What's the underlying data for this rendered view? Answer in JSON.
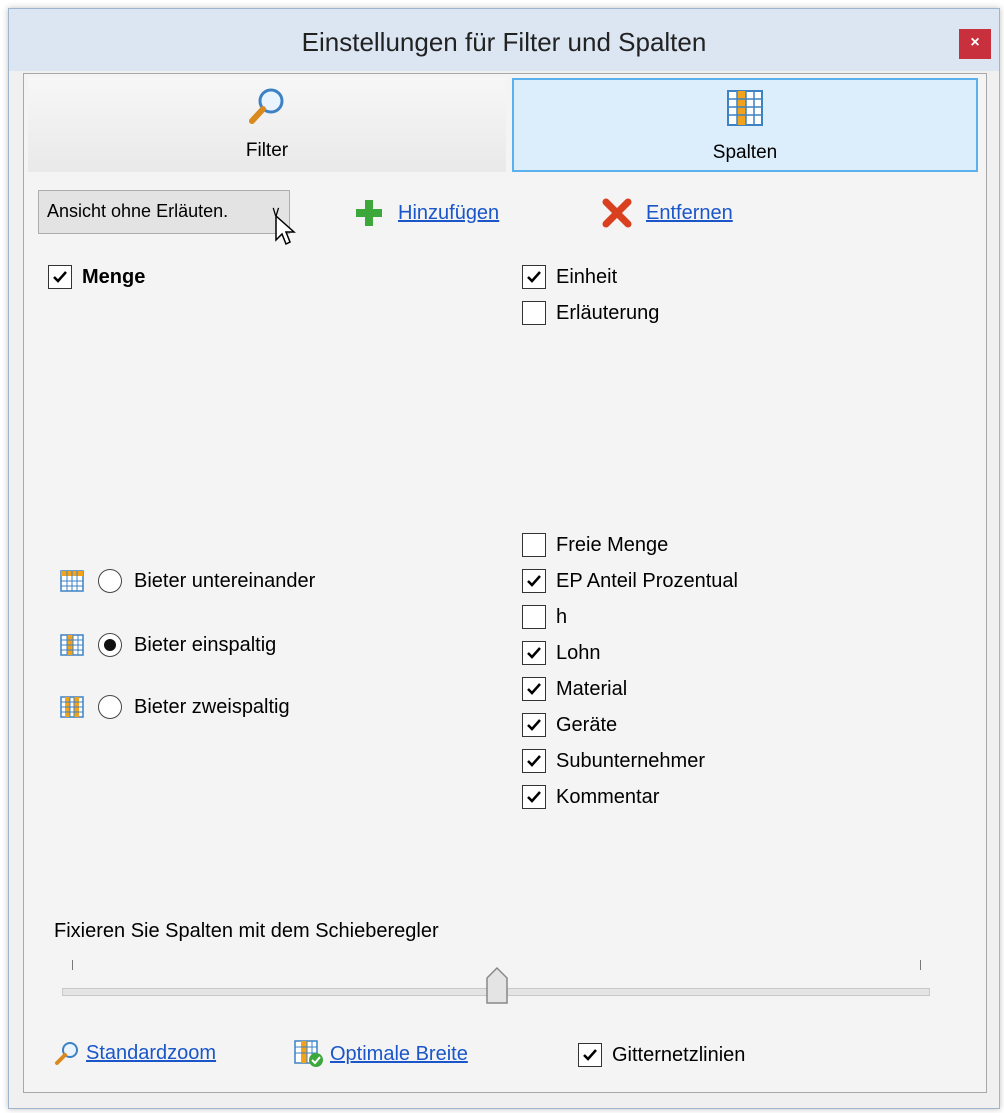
{
  "window": {
    "title": "Einstellungen für Filter und Spalten",
    "close_label": "×"
  },
  "tabs": [
    {
      "label": "Filter",
      "icon": "magnifier-icon",
      "active": false
    },
    {
      "label": "Spalten",
      "icon": "columns-grid-icon",
      "active": true
    }
  ],
  "toolbar": {
    "view_select_value": "Ansicht ohne Erläuten.",
    "add_label": "Hinzufügen",
    "remove_label": "Entfernen"
  },
  "left_columns": [
    {
      "label": "Menge",
      "checked": true,
      "bold": true
    }
  ],
  "right_top_columns": [
    {
      "label": "Einheit",
      "checked": true
    },
    {
      "label": "Erläuterung",
      "checked": false
    }
  ],
  "right_bottom_columns": [
    {
      "label": "Freie Menge",
      "checked": false
    },
    {
      "label": "EP Anteil Prozentual",
      "checked": true
    },
    {
      "label": "h",
      "checked": false
    },
    {
      "label": "Lohn",
      "checked": true
    },
    {
      "label": "Material",
      "checked": true
    },
    {
      "label": "Geräte",
      "checked": true
    },
    {
      "label": "Subunternehmer",
      "checked": true
    },
    {
      "label": "Kommentar",
      "checked": true
    }
  ],
  "bieter_layout": [
    {
      "label": "Bieter untereinander",
      "selected": false,
      "icon": "rows-layout-icon"
    },
    {
      "label": "Bieter einspaltig",
      "selected": true,
      "icon": "single-column-layout-icon"
    },
    {
      "label": "Bieter zweispaltig",
      "selected": false,
      "icon": "two-column-layout-icon"
    }
  ],
  "slider": {
    "label": "Fixieren Sie Spalten mit dem Schieberegler",
    "value_fraction": 0.5
  },
  "footer": {
    "standardzoom_label": "Standardzoom",
    "optimal_width_label": "Optimale Breite",
    "gridlines_label": "Gitternetzlinien",
    "gridlines_checked": true
  },
  "colors": {
    "accent": "#5db0ee",
    "link": "#1a56c9",
    "add": "#3ca83c",
    "remove": "#d9401f",
    "close": "#c7303c"
  }
}
